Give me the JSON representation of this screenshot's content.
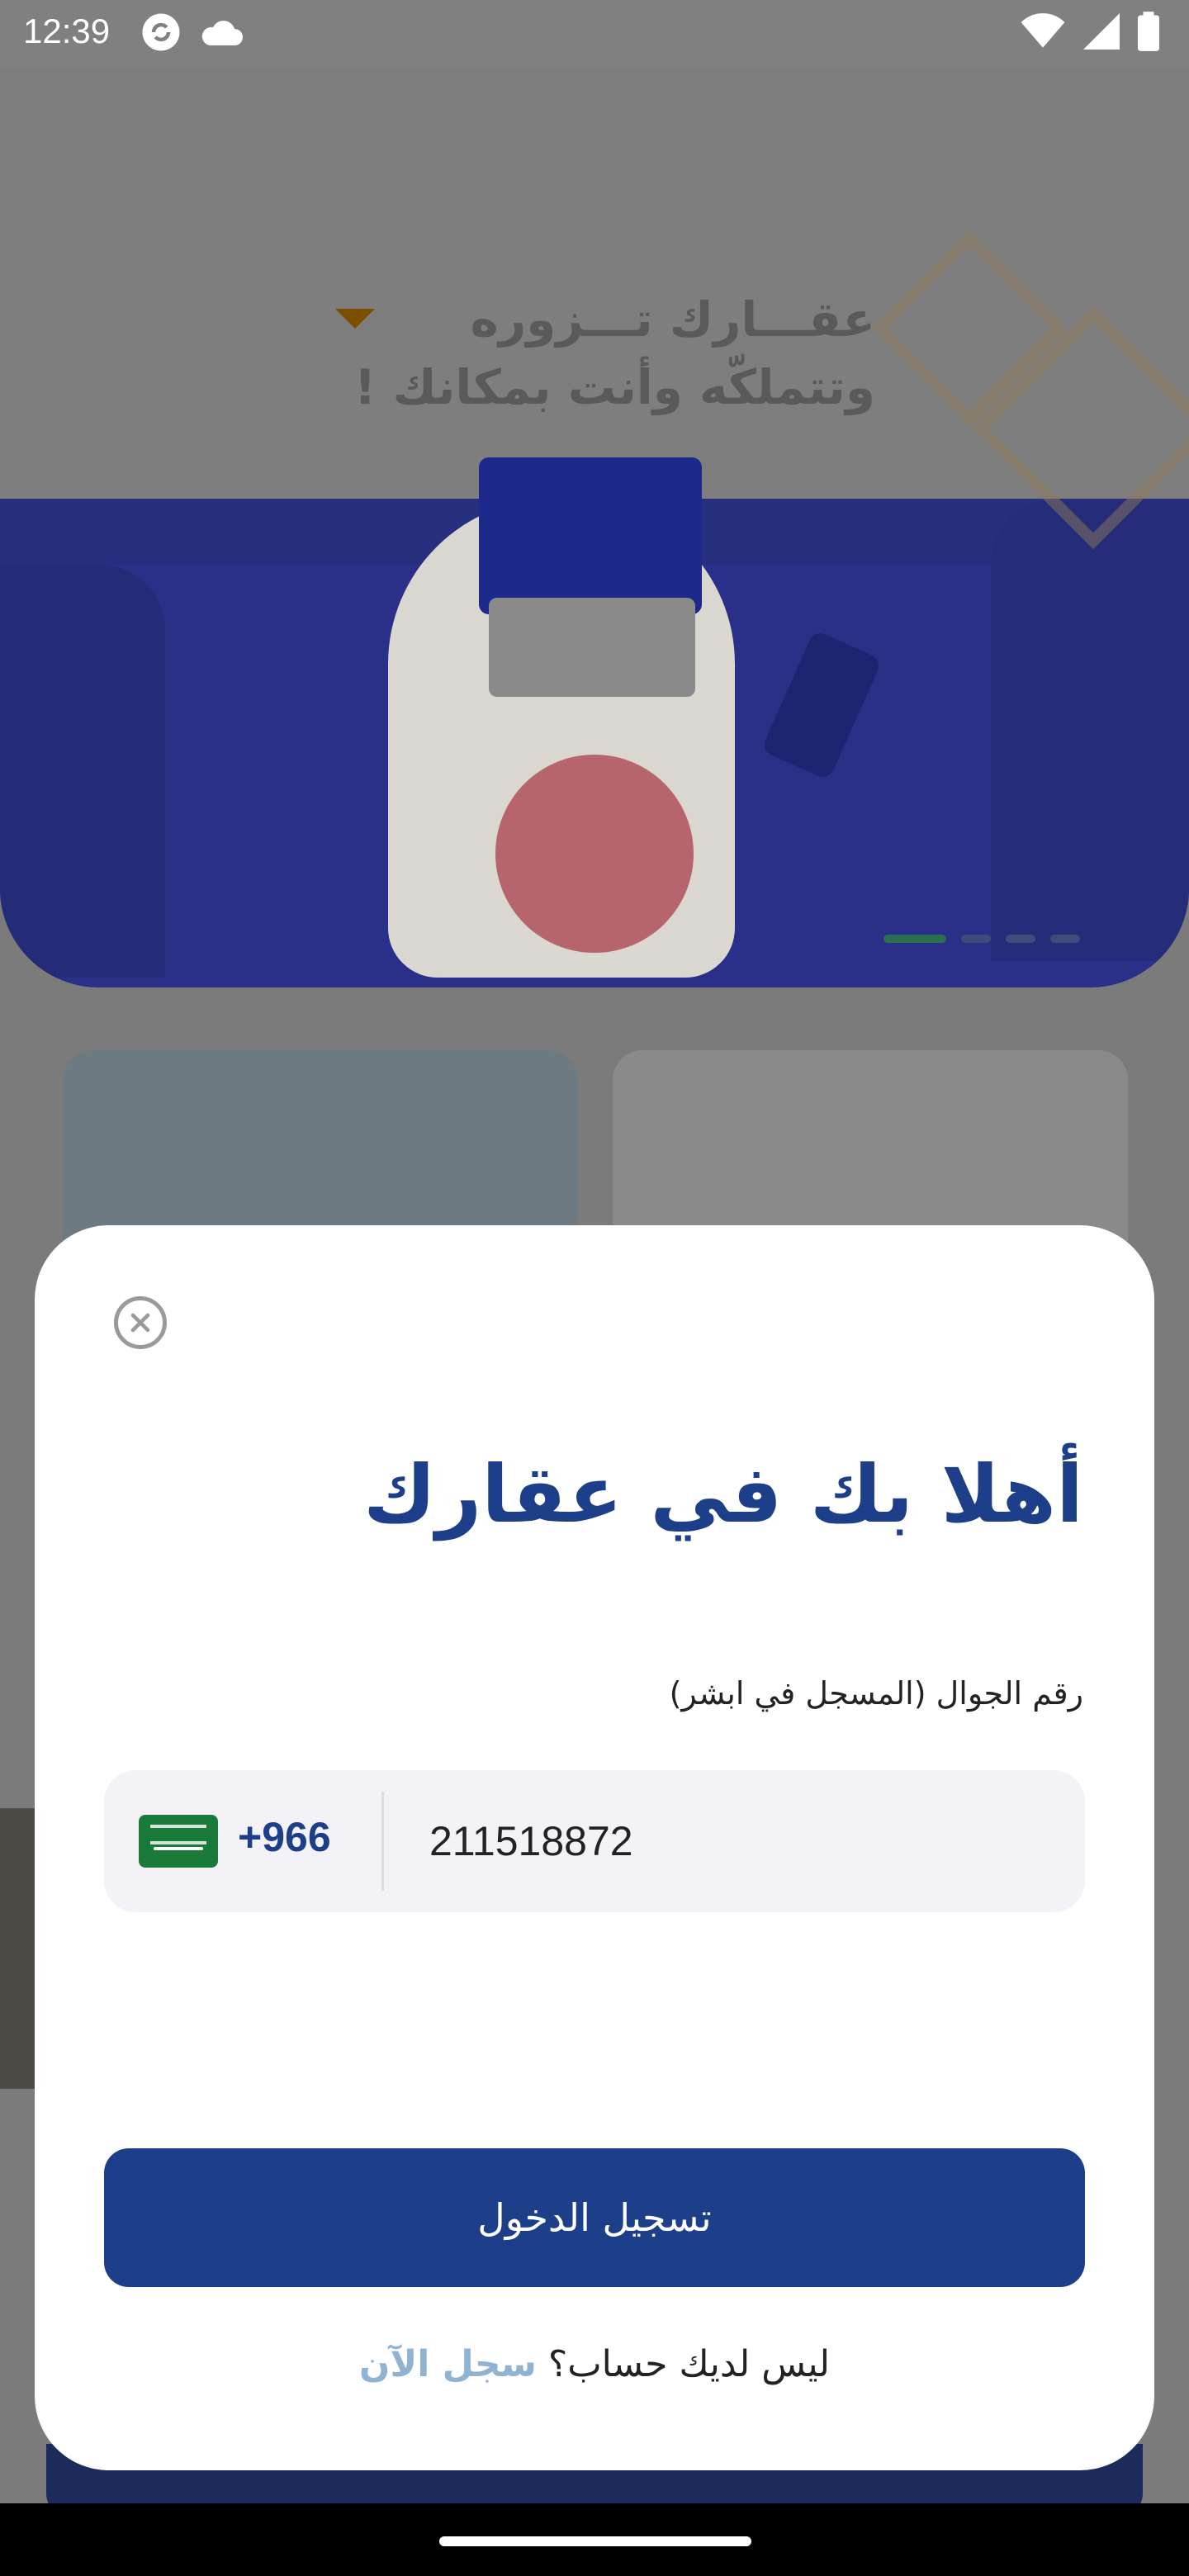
{
  "status_bar": {
    "time": "12:39",
    "icons_left": [
      "sync-icon",
      "cloud-icon"
    ],
    "icons_right": [
      "wifi-icon",
      "signal-icon",
      "battery-icon"
    ]
  },
  "banner": {
    "headline_line1": "عقـــارك تـــزوره",
    "headline_line2": "وتتملكّه وأنت بمكانك !",
    "slide_count": 4,
    "active_slide": 1
  },
  "login_sheet": {
    "title": "أهلا بك في عقارك",
    "phone_label": "رقم الجوال (المسجل في ابشر)",
    "country_code": "+966",
    "flag": "saudi-flag-icon",
    "phone_value": "211518872",
    "login_button": "تسجيل الدخول",
    "no_account_text": "ليس لديك حساب؟",
    "signup_link": "سجل الآن"
  },
  "colors": {
    "primary": "#1d3f8a",
    "link": "#8fb3d1",
    "field_bg": "#f3f3f7"
  }
}
